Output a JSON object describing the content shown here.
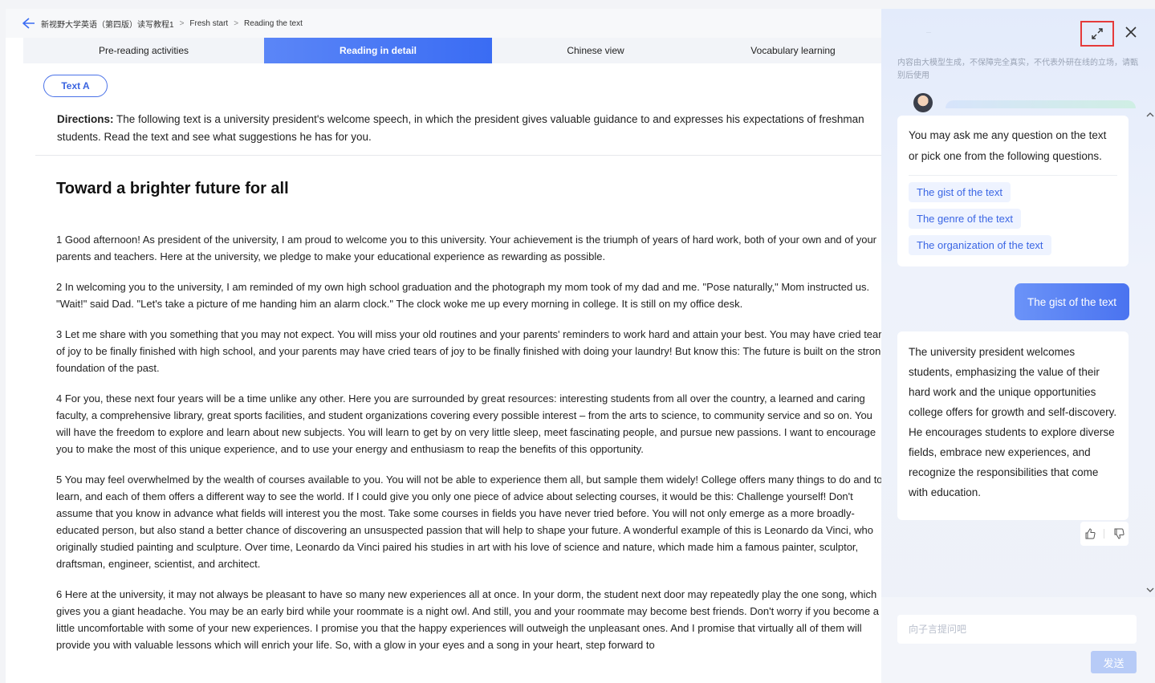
{
  "breadcrumb": {
    "items": [
      "新视野大学英语（第四版）读写教程1",
      "Fresh start",
      "Reading the text"
    ],
    "separator": ">"
  },
  "tabs": [
    {
      "label": "Pre-reading activities",
      "active": false
    },
    {
      "label": "Reading in detail",
      "active": true
    },
    {
      "label": "Chinese view",
      "active": false
    },
    {
      "label": "Vocabulary learning",
      "active": false
    }
  ],
  "text_button": "Text A",
  "directions": {
    "label": "Directions:",
    "text": " The following text is a university president's welcome speech, in which the president gives valuable guidance to and expresses his expectations of freshman students. Read the text and see what suggestions he has for you."
  },
  "article": {
    "title": "Toward a brighter future for all",
    "paragraphs": [
      "1 Good afternoon! As president of the university, I am proud to welcome you to this university. Your achievement is the triumph of years of hard work, both of your own and of your parents and teachers. Here at the university, we pledge to make your educational experience as rewarding as possible.",
      "2 In welcoming you to the university, I am reminded of my own high school graduation and the photograph my mom took of my dad and me. \"Pose naturally,\" Mom instructed us. \"Wait!\" said Dad. \"Let's take a picture of me handing him an alarm clock.\" The clock woke me up every morning in college. It is still on my office desk.",
      "3 Let me share with you something that you may not expect. You will miss your old routines and your parents' reminders to work hard and attain your best. You may have cried tears of joy to be finally finished with high school, and your parents may have cried tears of joy to be finally finished with doing your laundry! But know this: The future is built on the strong foundation of the past.",
      "4 For you, these next four years will be a time unlike any other. Here you are surrounded by great resources: interesting students from all over the country, a learned and caring faculty, a comprehensive library, great sports facilities, and student organizations covering every possible interest – from the arts to science, to community service and so on. You will have the freedom to explore and learn about new subjects. You will learn to get by on very little sleep, meet fascinating people, and pursue new passions. I want to encourage you to make the most of this unique experience, and to use your energy and enthusiasm to reap the benefits of this opportunity.",
      "5 You may feel overwhelmed by the wealth of courses available to you. You will not be able to experience them all, but sample them widely! College offers many things to do and to learn, and each of them offers a different way to see the world. If I could give you only one piece of advice about selecting courses, it would be this: Challenge yourself! Don't assume that you know in advance what fields will interest you the most. Take some courses in fields you have never tried before. You will not only emerge as a more broadly-educated person, but also stand a better chance of discovering an unsuspected passion that will help to shape your future. A wonderful example of this is Leonardo da Vinci, who originally studied painting and sculpture. Over time, Leonardo da Vinci paired his studies in art with his love of science and nature, which made him a famous painter, sculptor, draftsman, engineer, scientist, and architect.",
      "6 Here at the university, it may not always be pleasant to have so many new experiences all at once. In your dorm, the student next door may repeatedly play the one song, which gives you a giant headache. You may be an early bird while your roommate is a night owl. And still, you and your roommate may become best friends. Don't worry if you become a little uncomfortable with some of your new experiences. I promise you that the happy experiences will outweigh the unpleasant ones. And I promise that virtually all of them will provide you with valuable lessons which will enrich your life. So, with a glow in your eyes and a song in your heart, step forward to"
    ]
  },
  "chat": {
    "top_dots": "···",
    "disclaimer": "内容由大模型生成，不保障完全真实，不代表外研在线的立场，请甄别后使用",
    "intro": "You may ask me any question on the text or pick one from the following questions.",
    "suggestions": [
      "The gist of the text",
      "The genre of the text",
      "The organization of the text"
    ],
    "user_message": "The gist of the text",
    "answer": "The university president welcomes students, emphasizing the value of their hard work and the unique opportunities college offers for growth and self-discovery. He encourages students to explore diverse fields, embrace new experiences, and recognize the responsibilities that come with education.",
    "input_placeholder": "向子言提问吧",
    "send_label": "发送"
  },
  "colors": {
    "accent": "#3a6cf3",
    "highlight_border": "#e53a3a"
  }
}
